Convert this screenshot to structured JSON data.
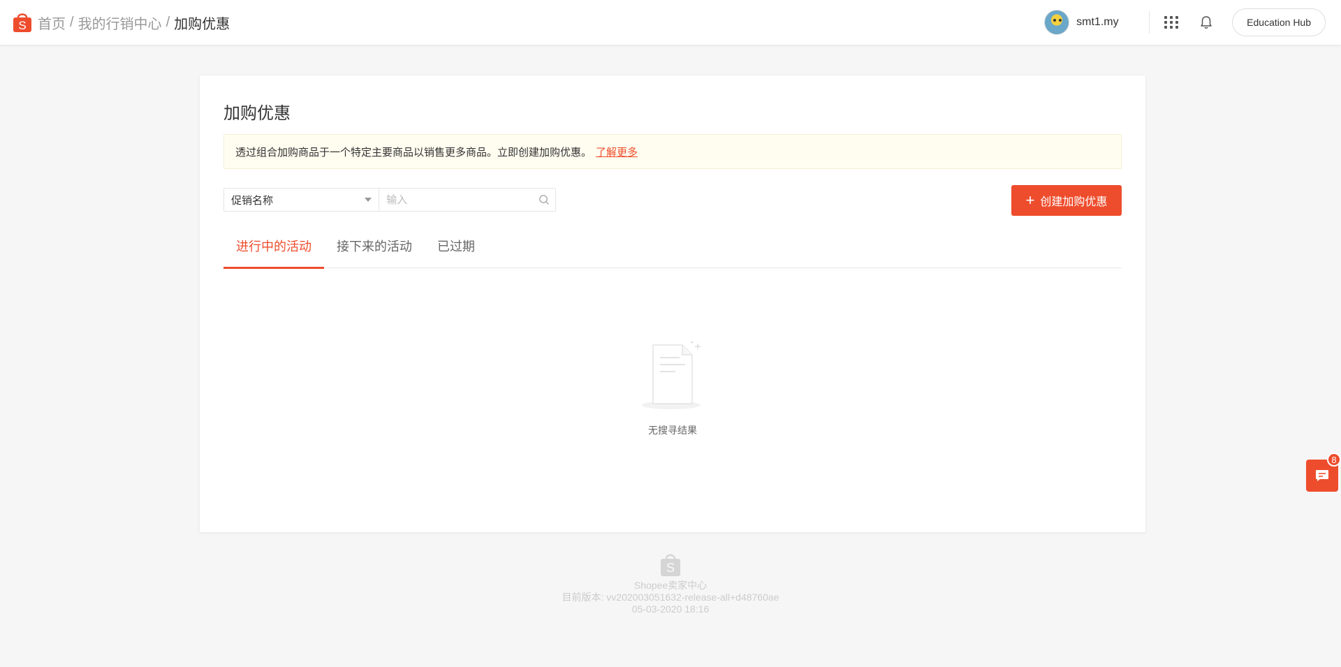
{
  "breadcrumb": {
    "home": "首页",
    "sep": "/",
    "marketing": "我的行销中心",
    "current": "加购优惠"
  },
  "user": {
    "name": "smt1.my"
  },
  "header": {
    "education_hub": "Education Hub"
  },
  "card": {
    "title": "加购优惠",
    "notice_text": "透过组合加购商品于一个特定主要商品以销售更多商品。立即创建加购优惠。",
    "notice_link": "了解更多",
    "filter_select": "促销名称",
    "search_placeholder": "输入",
    "create_button": "创建加购优惠",
    "tabs": [
      {
        "label": "进行中的活动"
      },
      {
        "label": "接下来的活动"
      },
      {
        "label": "已过期"
      }
    ],
    "empty_text": "无搜寻结果"
  },
  "footer": {
    "brand": "Shopee卖家中心",
    "version": "目前版本: vv202003051632-release-all+d48760ae",
    "date": "05-03-2020 18:16"
  },
  "chat": {
    "badge_count": "8"
  },
  "colors": {
    "brand": "#ee4d2d"
  }
}
